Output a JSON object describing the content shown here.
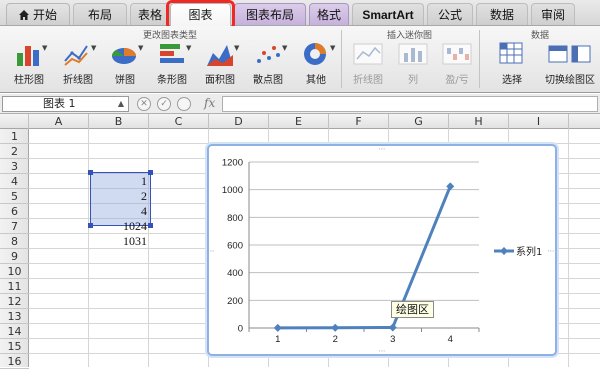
{
  "tabs": [
    {
      "label": "开始"
    },
    {
      "label": "布局"
    },
    {
      "label": "表格"
    },
    {
      "label": "图表"
    },
    {
      "label": "图表布局"
    },
    {
      "label": "格式"
    },
    {
      "label": "SmartArt"
    },
    {
      "label": "公式"
    },
    {
      "label": "数据"
    },
    {
      "label": "审阅"
    }
  ],
  "ribbon": {
    "group_change_type": "更改图表类型",
    "group_sparklines": "插入迷你图",
    "group_data": "数据",
    "buttons": [
      {
        "label": "柱形图"
      },
      {
        "label": "折线图"
      },
      {
        "label": "饼图"
      },
      {
        "label": "条形图"
      },
      {
        "label": "面积图"
      },
      {
        "label": "散点图"
      },
      {
        "label": "其他"
      },
      {
        "label": "折线图"
      },
      {
        "label": "列"
      },
      {
        "label": "盈/亏"
      },
      {
        "label": "选择"
      },
      {
        "label": "切换绘图区"
      }
    ]
  },
  "formula_bar": {
    "name_box": "图表 1",
    "fx": "fx"
  },
  "grid": {
    "columns": [
      "A",
      "B",
      "C",
      "D",
      "E",
      "F",
      "G",
      "H",
      "I"
    ],
    "rows": [
      "1",
      "2",
      "3",
      "4",
      "5",
      "6",
      "7",
      "8",
      "9",
      "10",
      "11",
      "12",
      "13",
      "14",
      "15",
      "16"
    ],
    "cells": [
      {
        "ref": "B4",
        "value": "1"
      },
      {
        "ref": "B5",
        "value": "2"
      },
      {
        "ref": "B6",
        "value": "4"
      },
      {
        "ref": "B7",
        "value": "1024"
      },
      {
        "ref": "B8",
        "value": "1031"
      }
    ]
  },
  "chart_data": {
    "type": "line",
    "categories": [
      "1",
      "2",
      "3",
      "4"
    ],
    "series": [
      {
        "name": "系列1",
        "values": [
          1,
          2,
          4,
          1024
        ]
      }
    ],
    "ylim": [
      0,
      1200
    ],
    "yticks": [
      "0",
      "200",
      "400",
      "600",
      "800",
      "1000",
      "1200"
    ],
    "grid": true,
    "legend": "right",
    "color": "#4f81bd"
  },
  "tooltip": "绘图区"
}
